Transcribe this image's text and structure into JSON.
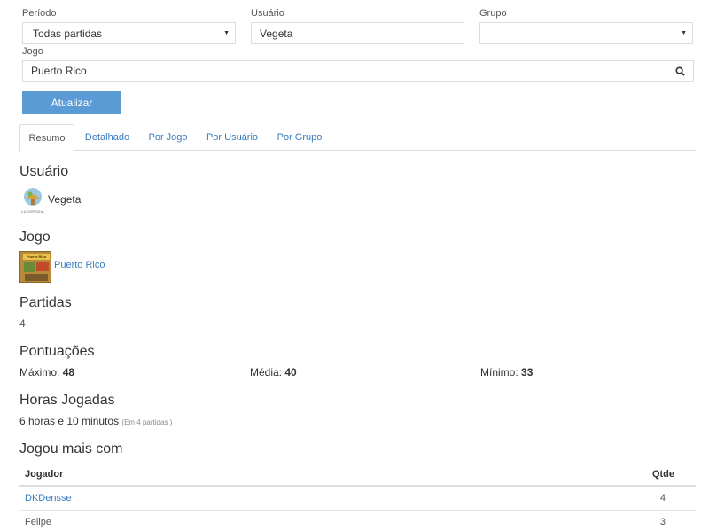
{
  "filters": {
    "period_label": "Período",
    "period_value": "Todas partidas",
    "user_label": "Usuário",
    "user_value": "Vegeta",
    "group_label": "Grupo",
    "group_value": "",
    "game_label": "Jogo",
    "game_value": "Puerto Rico",
    "update_label": "Atualizar"
  },
  "tabs": [
    {
      "label": "Resumo",
      "active": true
    },
    {
      "label": "Detalhado"
    },
    {
      "label": "Por Jogo"
    },
    {
      "label": "Por Usuário"
    },
    {
      "label": "Por Grupo"
    }
  ],
  "summary": {
    "user_heading": "Usuário",
    "user_name": "Vegeta",
    "avatar_caption": "LUDOPEDIA",
    "game_heading": "Jogo",
    "game_name": "Puerto Rico",
    "game_cover_text": "Puerto Rico",
    "matches_heading": "Partidas",
    "matches_value": "4",
    "scores_heading": "Pontuações",
    "max_label": "Máximo:",
    "max_value": "48",
    "avg_label": "Média:",
    "avg_value": "40",
    "min_label": "Mínimo:",
    "min_value": "33",
    "hours_heading": "Horas Jogadas",
    "hours_value": "6 horas e 10 minutos",
    "hours_note": "(Em 4 partidas )",
    "played_with_heading": "Jogou mais com"
  },
  "table": {
    "col_player": "Jogador",
    "col_qty": "Qtde",
    "rows": [
      {
        "player": "DKDensse",
        "qty": "4",
        "link": true
      },
      {
        "player": "Felipe",
        "qty": "3",
        "link": false
      }
    ]
  },
  "colors": {
    "accent": "#5b9bd5",
    "link": "#3a7bbf"
  }
}
